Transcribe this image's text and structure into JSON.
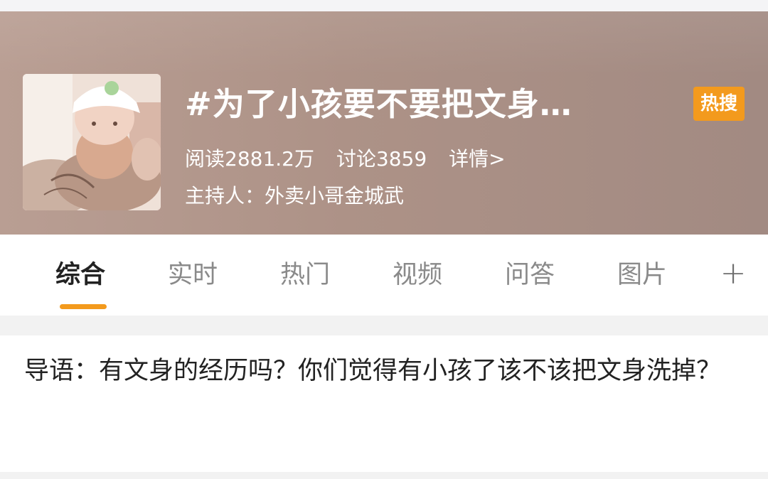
{
  "header": {
    "title": "#为了小孩要不要把文身…",
    "badge": "热搜",
    "stats": {
      "reads": "阅读2881.2万",
      "discussions": "讨论3859",
      "details": "详情>"
    },
    "host": "主持人：外卖小哥金城武",
    "colors": {
      "badge": "#f39a1d",
      "header_bg": "#ad9287"
    }
  },
  "tabs": {
    "items": [
      {
        "label": "综合",
        "active": true
      },
      {
        "label": "实时",
        "active": false
      },
      {
        "label": "热门",
        "active": false
      },
      {
        "label": "视频",
        "active": false
      },
      {
        "label": "问答",
        "active": false
      },
      {
        "label": "图片",
        "active": false
      }
    ],
    "more_icon": "plus-icon"
  },
  "intro": {
    "text": "导语：有文身的经历吗？你们觉得有小孩了该不该把文身洗掉？"
  }
}
